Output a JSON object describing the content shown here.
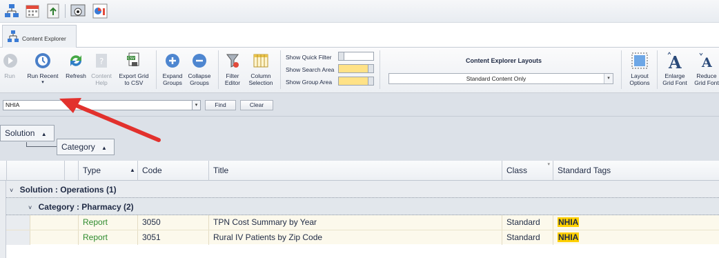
{
  "quick_access": {
    "icons": [
      "network-icon",
      "calendar-icon",
      "export-icon",
      "preview-icon",
      "chart-icon"
    ]
  },
  "doc_tab": {
    "label": "Content Explorer"
  },
  "ribbon": {
    "run": "Run",
    "run_recent": "Run Recent",
    "refresh": "Refresh",
    "content_help_1": "Content",
    "content_help_2": "Help",
    "export_1": "Export Grid",
    "export_2": "to CSV",
    "expand_1": "Expand",
    "expand_2": "Groups",
    "collapse_1": "Collapse",
    "collapse_2": "Groups",
    "filter_1": "Filter",
    "filter_2": "Editor",
    "column_1": "Column",
    "column_2": "Selection",
    "show_quick_filter": "Show Quick Filter",
    "show_search_area": "Show Search Area",
    "show_group_area": "Show Group Area",
    "layouts_title": "Content Explorer Layouts",
    "layout_value": "Standard Content Only",
    "layout_options_1": "Layout",
    "layout_options_2": "Options",
    "enlarge_1": "Enlarge",
    "enlarge_2": "Grid Font",
    "reduce_1": "Reduce",
    "reduce_2": "Grid Font"
  },
  "search": {
    "value": "NHIA",
    "find": "Find",
    "clear": "Clear"
  },
  "group_panel": {
    "solution": "Solution",
    "category": "Category"
  },
  "grid": {
    "columns": {
      "type": "Type",
      "code": "Code",
      "title": "Title",
      "class": "Class",
      "tags": "Standard Tags"
    },
    "group1": "Solution : Operations (1)",
    "group2": "Category : Pharmacy (2)",
    "rows": [
      {
        "type": "Report",
        "code": "3050",
        "title": "TPN Cost Summary by Year",
        "class": "Standard",
        "tag": "NHIA"
      },
      {
        "type": "Report",
        "code": "3051",
        "title": "Rural IV Patients by Zip Code",
        "class": "Standard",
        "tag": "NHIA"
      }
    ]
  },
  "colors": {
    "accent": "#e2312d",
    "tag_highlight": "#ffd000",
    "report_green": "#2e8b2e"
  }
}
